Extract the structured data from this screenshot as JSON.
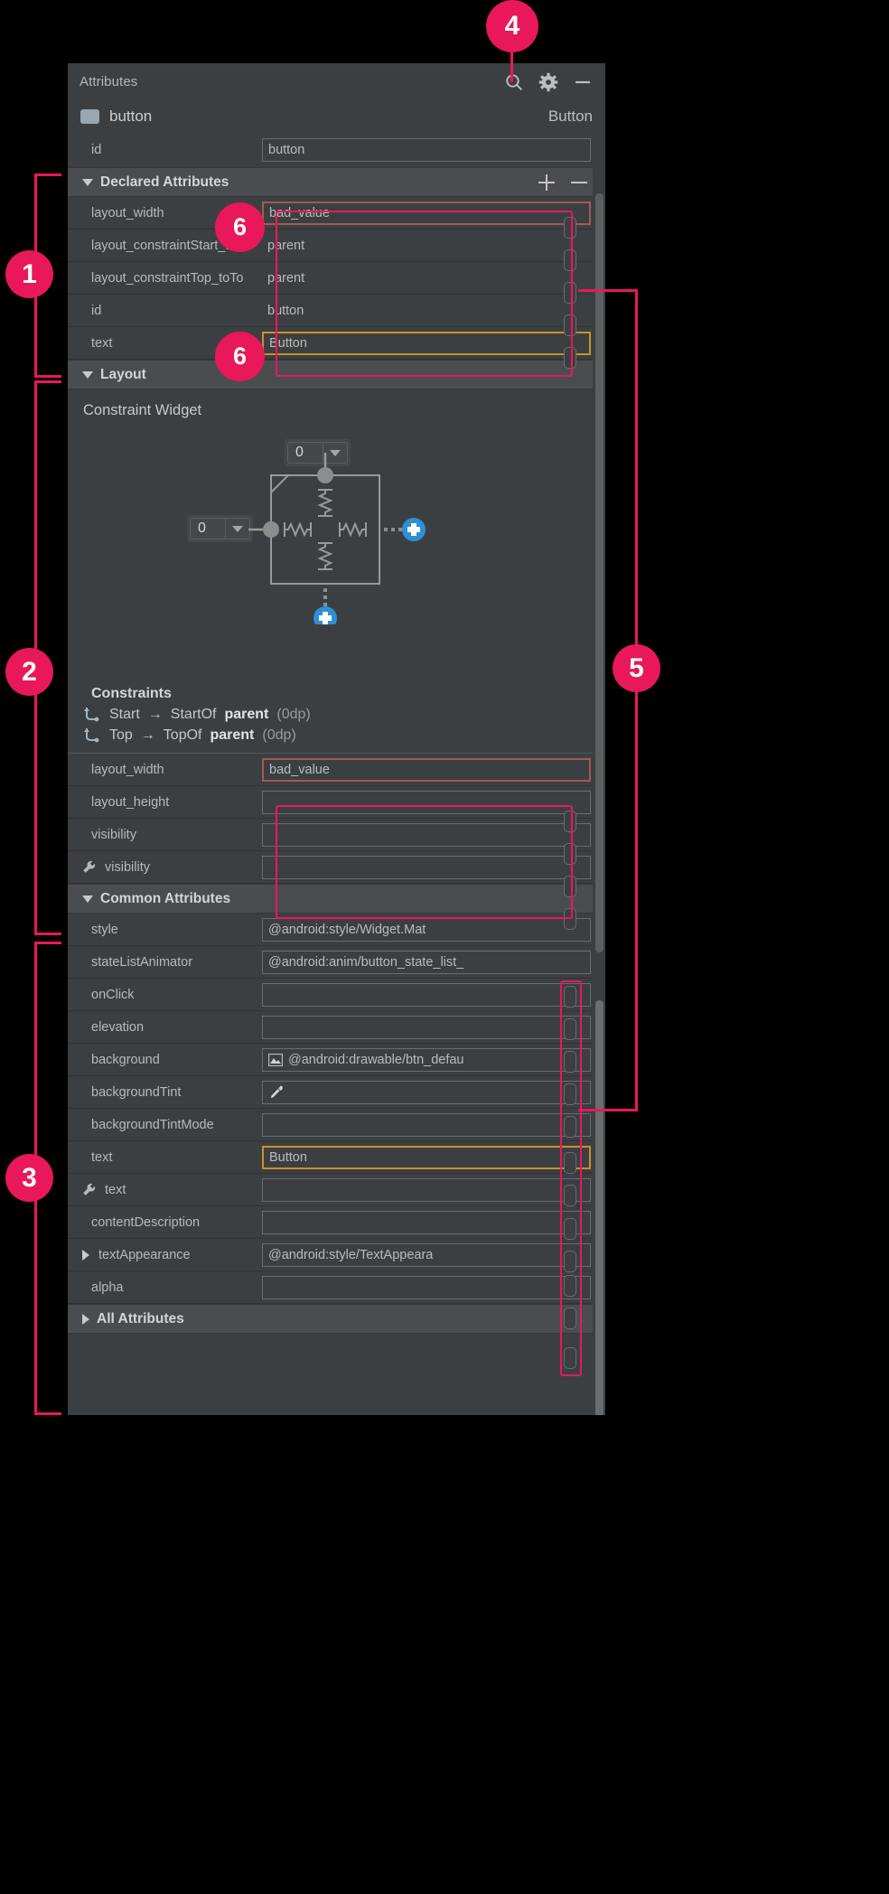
{
  "panel": {
    "title": "Attributes",
    "header_icons": [
      "search-icon",
      "gear-icon",
      "minimize-icon"
    ],
    "component": {
      "name": "button",
      "type": "Button"
    },
    "id_row": {
      "label": "id",
      "value": "button"
    }
  },
  "sections": {
    "declared": {
      "label": "Declared Attributes",
      "add_label": "+",
      "remove_label": "−",
      "rows": [
        {
          "label": "layout_width",
          "value": "bad_value",
          "state": "error",
          "dropdown": true
        },
        {
          "label": "layout_constraintStart_toSt",
          "value": "parent",
          "state": "flat",
          "dropdown": true
        },
        {
          "label": "layout_constraintTop_toTo",
          "value": "parent",
          "state": "flat",
          "dropdown": true
        },
        {
          "label": "id",
          "value": "button",
          "state": "flat",
          "dropdown": false
        },
        {
          "label": "text",
          "value": "Button",
          "state": "selected",
          "dropdown": false
        }
      ]
    },
    "layout": {
      "label": "Layout",
      "widget_title": "Constraint Widget",
      "top_margin_value": "0",
      "left_margin_value": "0",
      "constraints_label": "Constraints",
      "constraints": [
        {
          "side": "Start",
          "arrow": "→",
          "target_kind": "StartOf",
          "target": "parent",
          "margin": "(0dp)"
        },
        {
          "side": "Top",
          "arrow": "→",
          "target_kind": "TopOf",
          "target": "parent",
          "margin": "(0dp)"
        }
      ],
      "rows": [
        {
          "label": "layout_width",
          "value": "bad_value",
          "state": "error",
          "dropdown": true,
          "wrench": false
        },
        {
          "label": "layout_height",
          "value": "",
          "state": "normal",
          "dropdown": true,
          "wrench": false
        },
        {
          "label": "visibility",
          "value": "",
          "state": "normal",
          "dropdown": true,
          "wrench": false
        },
        {
          "label": "visibility",
          "value": "",
          "state": "normal",
          "dropdown": true,
          "wrench": true
        }
      ]
    },
    "common": {
      "label": "Common Attributes",
      "rows": [
        {
          "label": "style",
          "value": "@android:style/Widget.Mat",
          "state": "normal",
          "dropdown": true,
          "wrench": false,
          "icon": null,
          "expander": false
        },
        {
          "label": "stateListAnimator",
          "value": "@android:anim/button_state_list_",
          "state": "normal",
          "dropdown": false,
          "wrench": false,
          "icon": null,
          "expander": false
        },
        {
          "label": "onClick",
          "value": "",
          "state": "normal",
          "dropdown": true,
          "wrench": false,
          "icon": null,
          "expander": false
        },
        {
          "label": "elevation",
          "value": "",
          "state": "normal",
          "dropdown": false,
          "wrench": false,
          "icon": null,
          "expander": false
        },
        {
          "label": "background",
          "value": "@android:drawable/btn_defau",
          "state": "normal",
          "dropdown": false,
          "wrench": false,
          "icon": "image-icon",
          "expander": false
        },
        {
          "label": "backgroundTint",
          "value": "",
          "state": "normal",
          "dropdown": false,
          "wrench": false,
          "icon": "eyedropper-icon",
          "expander": false
        },
        {
          "label": "backgroundTintMode",
          "value": "",
          "state": "normal",
          "dropdown": true,
          "wrench": false,
          "icon": null,
          "expander": false
        },
        {
          "label": "text",
          "value": "Button",
          "state": "selected",
          "dropdown": false,
          "wrench": false,
          "icon": null,
          "expander": false
        },
        {
          "label": "text",
          "value": "",
          "state": "normal",
          "dropdown": false,
          "wrench": true,
          "icon": null,
          "expander": false
        },
        {
          "label": "contentDescription",
          "value": "",
          "state": "normal",
          "dropdown": false,
          "wrench": false,
          "icon": null,
          "expander": false
        },
        {
          "label": "textAppearance",
          "value": "@android:style/TextAppeara",
          "state": "normal",
          "dropdown": true,
          "wrench": false,
          "icon": null,
          "expander": true
        },
        {
          "label": "alpha",
          "value": "",
          "state": "normal",
          "dropdown": false,
          "wrench": false,
          "icon": null,
          "expander": false
        }
      ]
    },
    "all": {
      "label": "All Attributes"
    }
  },
  "annotations": {
    "callouts": [
      {
        "number": "1"
      },
      {
        "number": "2"
      },
      {
        "number": "3"
      },
      {
        "number": "4"
      },
      {
        "number": "5"
      },
      {
        "number": "6"
      },
      {
        "number": "6"
      }
    ],
    "accent_color": "#e8185a"
  }
}
